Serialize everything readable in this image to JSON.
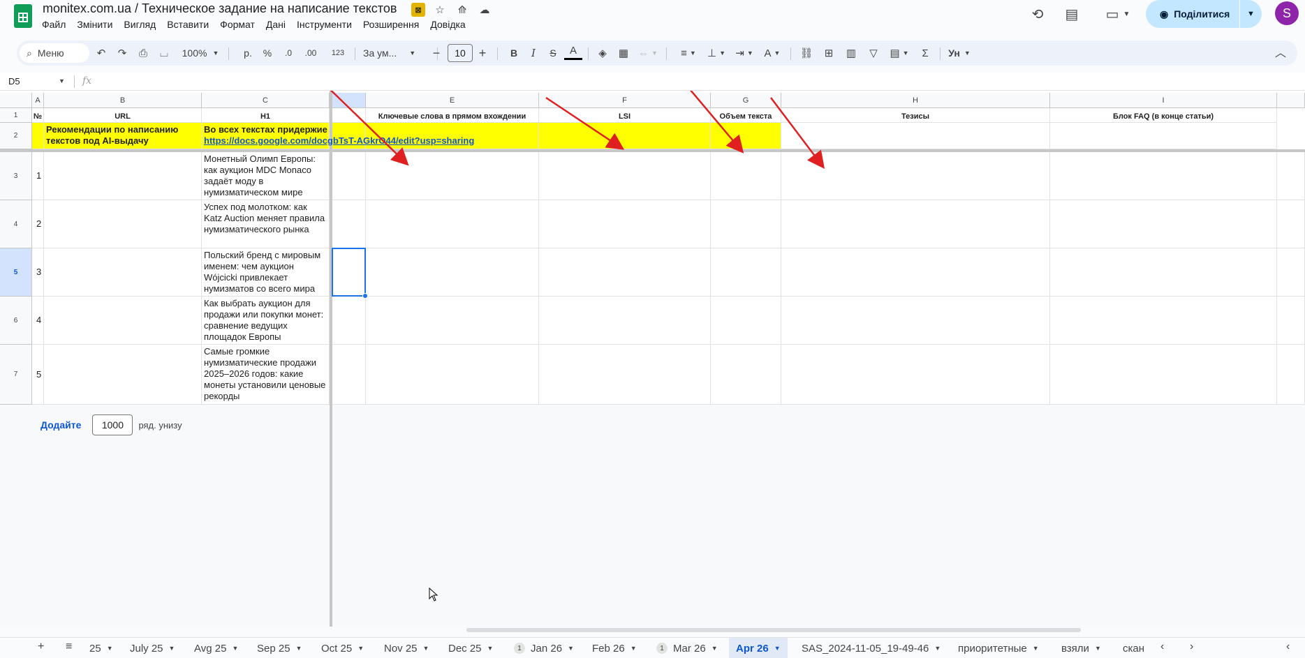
{
  "header": {
    "title": "monitex.com.ua / Техническое задание на написание текстов",
    "menu": [
      "Файл",
      "Змінити",
      "Вигляд",
      "Вставити",
      "Формат",
      "Дані",
      "Інструменти",
      "Розширення",
      "Довідка"
    ],
    "share_label": "Поділитися",
    "avatar_letter": "S"
  },
  "toolbar": {
    "search_label": "Меню",
    "zoom": "100%",
    "currency": "р.",
    "percent": "%",
    "dec_decrease": ".0",
    "dec_increase": ".00",
    "number_format": "123",
    "font": "За ум...",
    "font_size": "10"
  },
  "formula_bar": {
    "cell_ref": "D5",
    "fx": "fx"
  },
  "grid": {
    "columns": [
      "A",
      "B",
      "C",
      "E",
      "F",
      "G",
      "H",
      "I"
    ],
    "rows": [
      "1",
      "2",
      "3",
      "4",
      "5",
      "6",
      "7"
    ],
    "headers": {
      "a": "№",
      "b": "URL",
      "c": "H1",
      "e": "Ключевые слова в прямом вхождении",
      "f": "LSI",
      "g": "Объем текста",
      "h": "Тезисы",
      "i": "Блок FAQ (в конце статьи)"
    },
    "row2": {
      "b": "Рекомендации по написанию текстов под AI-выдачу",
      "c": "Во всех текстах придержие",
      "link": "https://docs.google.com/docgbTsT-AGkrO44/edit?usp=sharing"
    },
    "data_rows": [
      {
        "num": "1",
        "h1": "Монетный Олимп Европы: как аукцион MDC Monaco задаёт моду в нумизматическом мире"
      },
      {
        "num": "2",
        "h1": "Успех под молотком: как Katz Auction меняет правила нумизматического рынка"
      },
      {
        "num": "3",
        "h1": "Польский бренд с мировым именем: чем аукцион Wójcicki привлекает нумизматов со всего мира"
      },
      {
        "num": "4",
        "h1": "Как выбрать аукцион для продажи или покупки монет: сравнение ведущих площадок Европы"
      },
      {
        "num": "5",
        "h1": "Самые громкие нумизматические продажи 2025–2026 годов: какие монеты установили ценовые рекорды"
      }
    ]
  },
  "add_rows": {
    "button": "Додайте",
    "count": "1000",
    "label": "ряд. унизу"
  },
  "sheet_tabs": [
    {
      "label": "25",
      "active": false
    },
    {
      "label": "July 25",
      "active": false
    },
    {
      "label": "Avg 25",
      "active": false
    },
    {
      "label": "Sep 25",
      "active": false
    },
    {
      "label": "Oct 25",
      "active": false
    },
    {
      "label": "Nov 25",
      "active": false
    },
    {
      "label": "Dec 25",
      "active": false
    },
    {
      "label": "Jan 26",
      "active": false,
      "badge": "1"
    },
    {
      "label": "Feb 26",
      "active": false
    },
    {
      "label": "Mar 26",
      "active": false,
      "badge": "1"
    },
    {
      "label": "Apr 26",
      "active": true
    },
    {
      "label": "SAS_2024-11-05_19-49-46",
      "active": false
    },
    {
      "label": "приоритетные",
      "active": false
    },
    {
      "label": "взяли",
      "active": false
    },
    {
      "label": "скан",
      "active": false,
      "no_caret": true
    }
  ],
  "colors": {
    "highlight": "#ffff00",
    "accent": "#0b57d0",
    "annotation_arrow": "#e02020"
  }
}
